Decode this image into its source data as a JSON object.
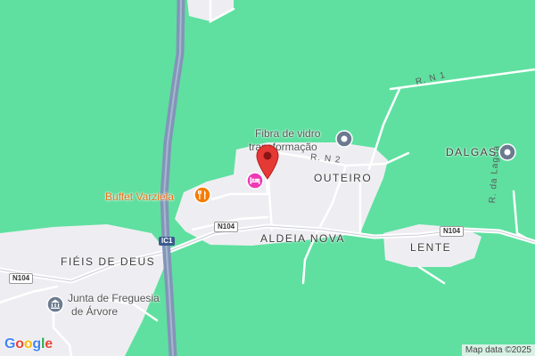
{
  "map": {
    "colors": {
      "land": "#5fe0a0",
      "built_up": "#eeeef2",
      "road": "#ffffff",
      "highway": "#8295b8",
      "pin": "#e53935",
      "food_poi": "#f57c00",
      "lodging_poi": "#ee3ab4",
      "civic_poi": "#6b7a8f"
    },
    "places": {
      "outeiro": "OUTEIRO",
      "aldeia_nova": "ALDEIA NOVA",
      "fieis_de_deus": "FIÉIS DE DEUS",
      "lente": "LENTE",
      "dalgas": "DALGAS"
    },
    "pois": {
      "fibra_line1": "Fibra de vidro",
      "fibra_line2": "transformação",
      "buffet": "Buffet Varziela",
      "junta_line1": "Junta de Freguesia",
      "junta_line2": "de Árvore"
    },
    "roads": {
      "rn1": "R. N 1",
      "rn2": "R. N 2",
      "lagoa": "R. da Lagoa"
    },
    "shields": {
      "ic1": "IC1",
      "n104_a": "N104",
      "n104_b": "N104",
      "n104_c": "N104"
    },
    "icons": {
      "pin": "map-pin-icon",
      "food": "restaurant-icon",
      "lodging": "hotel-icon",
      "civic": "institution-icon",
      "landmark": "place-icon"
    },
    "branding": {
      "logo_text": "Google",
      "attribution": "Map data ©2025"
    }
  }
}
